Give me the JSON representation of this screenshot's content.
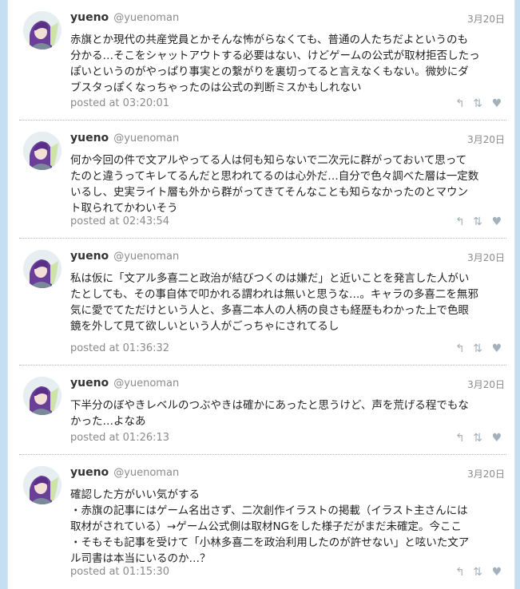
{
  "tweets": [
    {
      "name": "yueno",
      "handle": "@yuenoman",
      "date": "3月20日",
      "text": "赤旗とか現代の共産党員とかそんな怖がらなくても、普通の人たちだよというのも\n分かる…そこをシャットアウトする必要はない、けどゲームの公式が取材拒否したっ\nぽいというのがやっぱり事実との繋がりを裏切ってると言えなくもない。微妙にダ\nブスタっぽくなっちゃったのは公式の判断ミスかもしれない",
      "posted": "posted at 03:20:01"
    },
    {
      "name": "yueno",
      "handle": "@yuenoman",
      "date": "3月20日",
      "text": "何か今回の件で文アルやってる人は何も知らないで二次元に群がっておいて思って\nたのと違うってキレてるんだと思われてるのは心外だ…自分で色々調べた層は一定数\nいるし、史実ライト層も外から群がってきてそんなことも知らなかったのとマウン\nト取られてかわいそう",
      "posted": "posted at 02:43:54"
    },
    {
      "name": "yueno",
      "handle": "@yuenoman",
      "date": "3月20日",
      "text": "私は仮に「文アル多喜二と政治が結びつくのは嫌だ」と近いことを発言した人がい\nたとしても、その事自体で叩かれる謂われは無いと思うな…。キャラの多喜二を無邪\n気に愛でてただけという人と、多喜二本人の人柄の良さも経歴もわかった上で色眼\n鏡を外して見て欲しいという人がごっちゃにされてるし",
      "posted": "posted at 01:36:32"
    },
    {
      "name": "yueno",
      "handle": "@yuenoman",
      "date": "3月20日",
      "text": "下半分のぼやきレベルのつぶやきは確かにあったと思うけど、声を荒げる程でもな\nかった…よなあ",
      "posted": "posted at 01:26:13"
    },
    {
      "name": "yueno",
      "handle": "@yuenoman",
      "date": "3月20日",
      "text": "確認した方がいい気がする\n・赤旗の記事にはゲーム名出さず、二次創作イラストの掲載（イラスト主さんには\n取材がされている）→ゲーム公式側は取材NGをした様子だがまだ未確定。今ここ\n・そもそも記事を受けて「小林多喜二を政治利用したのが許せない」と呟いた文ア\nル司書は本当にいるのか…？",
      "posted": "posted at 01:15:30"
    }
  ],
  "icons": {
    "reply": "reply-icon",
    "retweet": "retweet-icon",
    "favorite": "heart-icon"
  },
  "colors": {
    "background": "#c6def1",
    "icon": "#a3b1bb"
  }
}
